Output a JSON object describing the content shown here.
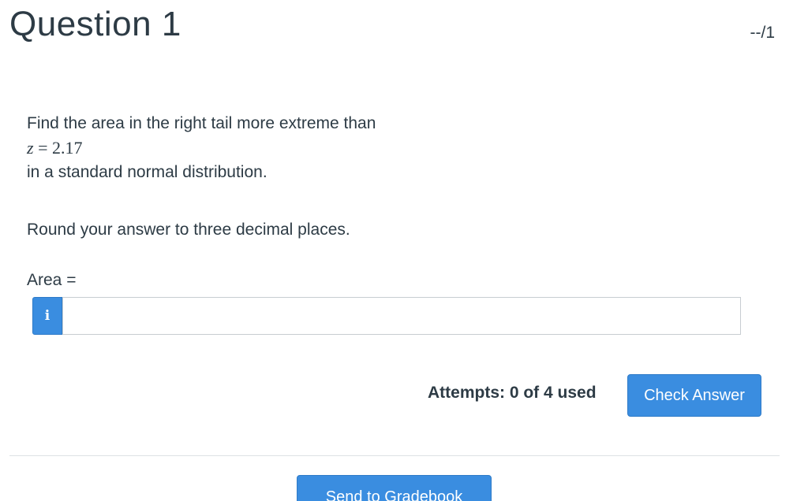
{
  "question": {
    "title": "Question 1",
    "score": "--/1",
    "prompt_line1": "Find the area in the right tail more extreme than",
    "math_var": "z",
    "math_rest": " = 2.17",
    "prompt_line2": "in a standard normal distribution.",
    "instruction": "Round your answer to three decimal places.",
    "answer_label": "Area =",
    "answer_value": "",
    "answer_placeholder": ""
  },
  "info_icon": {
    "glyph": "i",
    "icon": "info-icon"
  },
  "footer": {
    "attempts": "Attempts: 0 of 4 used",
    "check_answer": "Check Answer",
    "send_to_gradebook": "Send to Gradebook"
  },
  "colors": {
    "primary_button": "#3a8de0",
    "text": "#2d3b45",
    "border": "#c7cdd1"
  }
}
